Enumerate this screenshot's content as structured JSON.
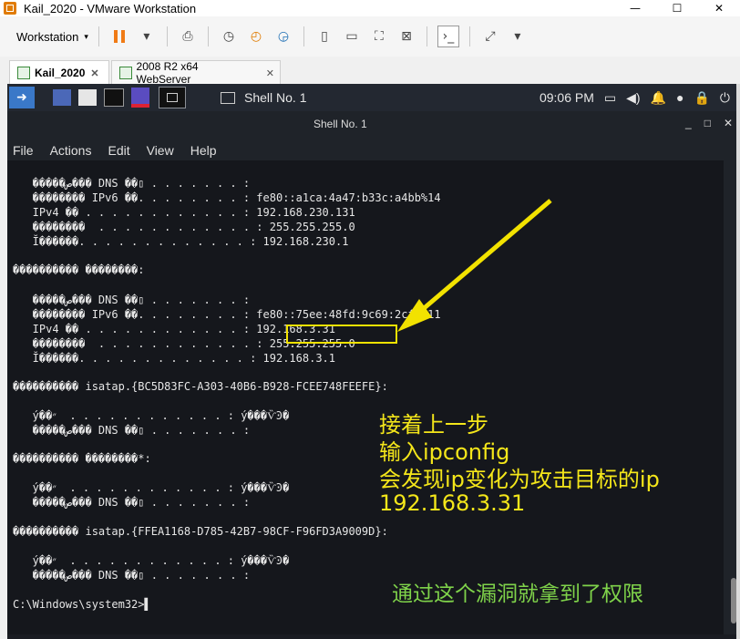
{
  "window": {
    "title": "Kail_2020 - VMware Workstation",
    "controls": [
      "—",
      "☐",
      "✕"
    ]
  },
  "toolbar": {
    "menu_label": "Workstation",
    "caret": "▾"
  },
  "tabs": [
    {
      "label": "Kail_2020",
      "close": "✕"
    },
    {
      "label": "2008 R2 x64 WebServer",
      "close": "✕"
    }
  ],
  "kali": {
    "task_label": "Shell No. 1",
    "clock": "09:06 PM"
  },
  "terminal": {
    "title": "Shell No. 1",
    "controls": [
      "_",
      "□",
      "✕"
    ],
    "menu": [
      "File",
      "Actions",
      "Edit",
      "View",
      "Help"
    ],
    "lines": [
      "   �����ص��� DNS ��▯ . . . . . . . :",
      "   �������� IPv6 ��. . . . . . . . : fe80::a1ca:4a47:b33c:a4bb%14",
      "   IPv4 �� . . . . . . . . . . . . : 192.168.230.131",
      "   ��������  . . . . . . . . . . . . : 255.255.255.0",
      "   Ĭ������. . . . . . . . . . . . . : 192.168.230.1",
      "",
      "���������� ��������:",
      "",
      "   �����ص��� DNS ��▯ . . . . . . . :",
      "   �������� IPv6 ��. . . . . . . . : fe80::75ee:48fd:9c69:2cfd%11",
      "   IPv4 �� . . . . . . . . . . . . : 192.168.3.31",
      "   ��������  . . . . . . . . . . . . : 255.255.255.0",
      "   Ĭ������. . . . . . . . . . . . . : 192.168.3.1",
      "",
      "���������� isatap.{BC5D83FC-A303-40B6-B928-FCEE748FEEFE}:",
      "",
      "   ý��״  . . . . . . . . . . . . : ý���ѶϿ�",
      "   �����ص��� DNS ��▯ . . . . . . . :",
      "",
      "���������� ��������*:",
      "",
      "   ý��״  . . . . . . . . . . . . : ý���ѶϿ�",
      "   �����ص��� DNS ��▯ . . . . . . . :",
      "",
      "���������� isatap.{FFEA1168-D785-42B7-98CF-F96FD3A9009D}:",
      "",
      "   ý��״  . . . . . . . . . . . . : ý���ѶϿ�",
      "   �����ص��� DNS ��▯ . . . . . . . :",
      "",
      "C:\\Windows\\system32>▌"
    ]
  },
  "annotations": {
    "line1": "接着上一步",
    "line2": "输入ipconfig",
    "line3": "会发现ip变化为攻击目标的ip",
    "line4": "192.168.3.31",
    "bottom": "通过这个漏洞就拿到了权限"
  },
  "colors": {
    "annotation_yellow": "#f4e61a",
    "annotation_green": "#7fd34a",
    "terminal_bg": "#15171c"
  }
}
